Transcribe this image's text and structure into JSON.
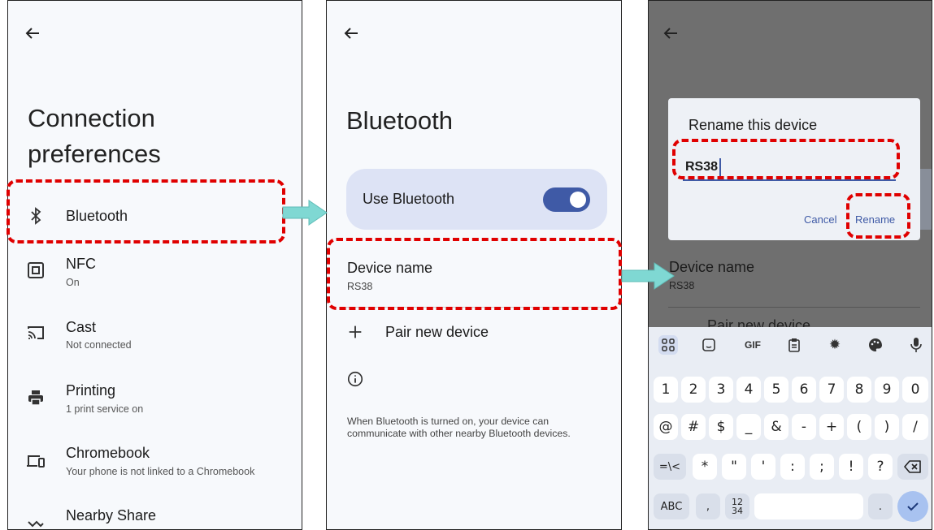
{
  "panel1": {
    "title_line1": "Connection",
    "title_line2": "preferences",
    "items": [
      {
        "icon": "bluetooth-icon",
        "title": "Bluetooth",
        "subtitle": ""
      },
      {
        "icon": "nfc-icon",
        "title": "NFC",
        "subtitle": "On"
      },
      {
        "icon": "cast-icon",
        "title": "Cast",
        "subtitle": "Not connected"
      },
      {
        "icon": "print-icon",
        "title": "Printing",
        "subtitle": "1 print service on"
      },
      {
        "icon": "chromebook-icon",
        "title": "Chromebook",
        "subtitle": "Your phone is not linked to a Chromebook"
      },
      {
        "icon": "nearby-share-icon",
        "title": "Nearby Share",
        "subtitle": ""
      }
    ]
  },
  "panel2": {
    "title": "Bluetooth",
    "use_bluetooth_label": "Use Bluetooth",
    "use_bluetooth_on": true,
    "device_name_label": "Device name",
    "device_name_value": "RS38",
    "pair_label": "Pair new device",
    "info_text_line1": "When Bluetooth is turned on, your device can",
    "info_text_line2": "communicate with other nearby Bluetooth devices."
  },
  "panel3": {
    "dialog_title": "Rename this device",
    "input_value": "RS38",
    "cancel_label": "Cancel",
    "rename_label": "Rename",
    "bg_device_name": "Device name",
    "bg_device_value": "RS38",
    "bg_pair": "Pair new device",
    "toolbar": [
      "apps-icon",
      "sticker-icon",
      "GIF",
      "clipboard-icon",
      "settings-icon",
      "palette-icon",
      "mic-icon"
    ],
    "row1": [
      "1",
      "2",
      "3",
      "4",
      "5",
      "6",
      "7",
      "8",
      "9",
      "0"
    ],
    "row2": [
      "@",
      "#",
      "$",
      "_",
      "&",
      "-",
      "+",
      "(",
      ")",
      "/"
    ],
    "row3": [
      "=\\<",
      "*",
      "\"",
      "'",
      ":",
      ";",
      "!",
      "?"
    ],
    "abc_label": "ABC",
    "comma": ",",
    "num_top": "12",
    "num_bottom": "34",
    "period": "."
  },
  "colors": {
    "accent_red": "#e00000",
    "arrow_teal": "#7fd8d3",
    "toggle": "#3f5aa6"
  }
}
